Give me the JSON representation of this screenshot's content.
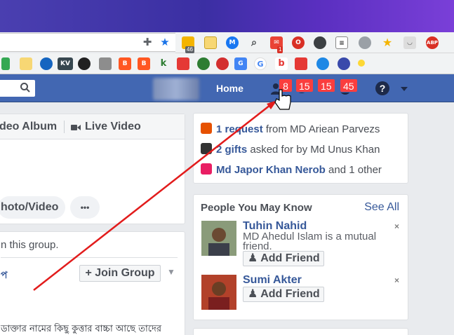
{
  "browser": {
    "colors": {
      "titlebar": "#4a3fb0",
      "toolbar": "#f1f3f4"
    },
    "ext_badges": {
      "ext2": "46",
      "gmail": "1"
    },
    "bookmark_labels": {
      "kv": "KV",
      "b": "b"
    },
    "abp_label": "ABP",
    "icons": [
      "puzzle-icon",
      "star-icon"
    ]
  },
  "fb": {
    "colors": {
      "bar": "#4267b2",
      "badge": "#fa3e3e",
      "link": "#365899"
    },
    "home": "Home",
    "badges": {
      "friends": "8",
      "messages": "15",
      "notifications": "15",
      "other": "45"
    },
    "help": "?"
  },
  "composer": {
    "video_album": "deo Album",
    "live_video": "Live Video",
    "photo_video": "hoto/Video",
    "more": "•••"
  },
  "group": {
    "note": "n this group.",
    "text_fragment": "প",
    "join_label": "Join Group",
    "bengali_line": "ডাক্তার নামের কিছু কুত্তার বাচ্চা আছে তাদের"
  },
  "notifications": {
    "row1": {
      "bold": "1 request",
      "rest": " from MD Ariean Parvezs"
    },
    "row2": {
      "bold": "2 gifts",
      "rest": " asked for by Md Unus Khan"
    },
    "row3": {
      "bold": "Md Japor Khan Nerob",
      "rest": " and 1 other"
    }
  },
  "pymk": {
    "title": "People You May Know",
    "see_all": "See All",
    "people": [
      {
        "name": "Tuhin Nahid",
        "mutual": "MD Ahedul Islam is a mutual friend.",
        "button": "Add Friend"
      },
      {
        "name": "Sumi Akter",
        "button": "Add Friend"
      }
    ],
    "close": "×"
  }
}
